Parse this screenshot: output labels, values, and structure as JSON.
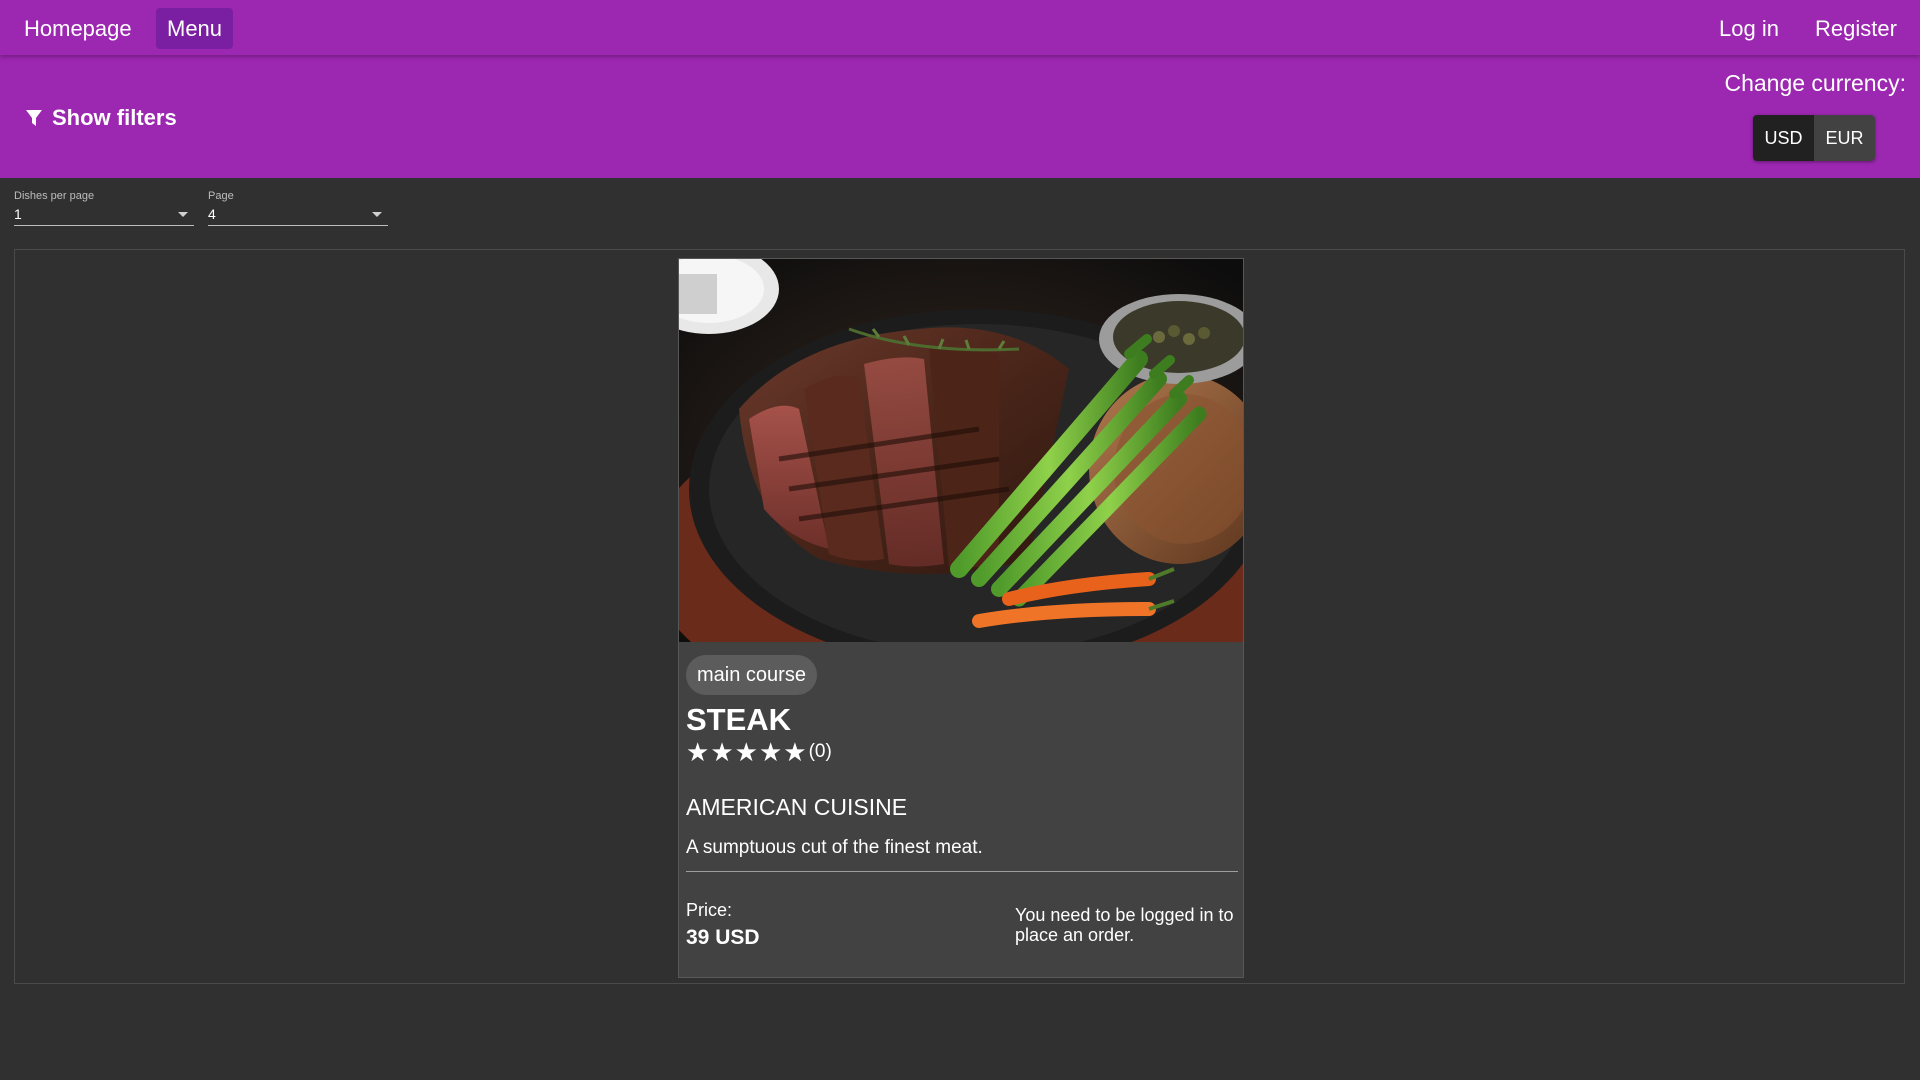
{
  "nav": {
    "homepage": "Homepage",
    "menu": "Menu",
    "login": "Log in",
    "register": "Register",
    "active_item": "Menu"
  },
  "filters": {
    "show_filters_label": "Show filters",
    "icon": "filter-funnel-icon"
  },
  "currency": {
    "label": "Change currency:",
    "options": [
      "USD",
      "EUR"
    ],
    "selected": "USD"
  },
  "pagination": {
    "per_page_label": "Dishes per page",
    "per_page_value": "1",
    "page_label": "Page",
    "page_value": "4"
  },
  "dish": {
    "image_alt": "steak with asparagus and carrots on a cast iron plate",
    "category": "main course",
    "name": "STEAK",
    "rating_stars": 5,
    "rating_count": "(0)",
    "cuisine": "AMERICAN CUISINE",
    "description": "A sumptuous cut of the finest meat.",
    "price_label": "Price:",
    "price": "39 USD",
    "order_note": "You need to be logged in to place an order."
  },
  "colors": {
    "primary": "#9c27b0",
    "primary_dark": "#7b1fa2",
    "background": "#303030",
    "card": "#424242"
  }
}
